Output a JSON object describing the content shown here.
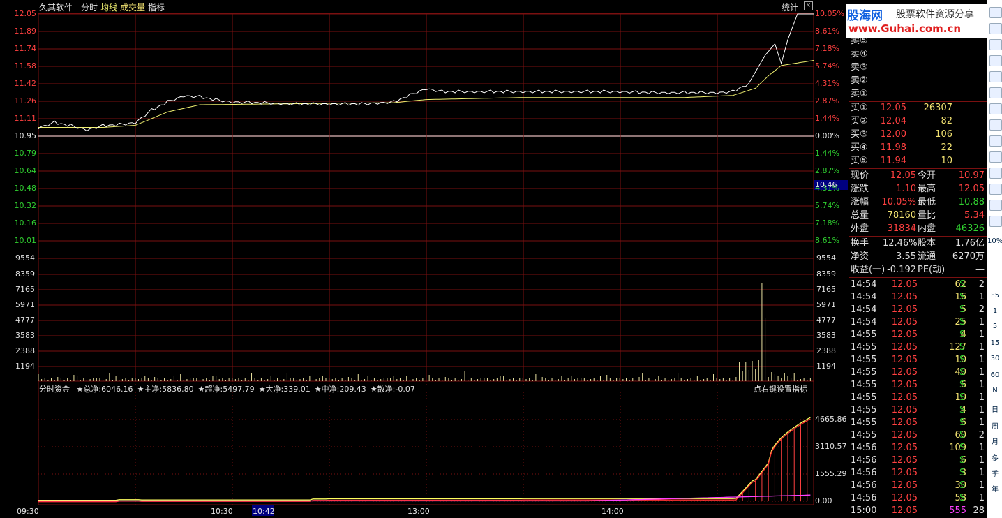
{
  "topbar": {
    "app": "久其软件",
    "tabs": [
      "分时",
      "均线",
      "成交量",
      "指标"
    ],
    "stat": "统计"
  },
  "colors": {
    "price_line": "#ffffff",
    "avg_line": "#f0f070",
    "up": "#ff4040",
    "down": "#30d030",
    "grid": "#7a1010",
    "capital_main": "#ff3030",
    "capital_total": "#ffff60",
    "capital_small": "#ff40ff"
  },
  "price_axis": {
    "left": [
      "12.05",
      "11.89",
      "11.74",
      "11.58",
      "11.42",
      "11.26",
      "11.11",
      "10.95",
      "10.79",
      "10.64",
      "10.48",
      "10.32",
      "10.16",
      "10.01"
    ],
    "right": [
      "10.05%",
      "8.61%",
      "7.18%",
      "5.74%",
      "4.31%",
      "2.87%",
      "1.44%",
      "0.00%",
      "1.44%",
      "2.87%",
      "4.31%",
      "5.74%",
      "7.18%",
      "8.61%"
    ],
    "prev_close": 10.95,
    "max": 12.05,
    "min": 9.85,
    "cursor_label": "10.46"
  },
  "volume_axis": [
    "9554",
    "8359",
    "7165",
    "5971",
    "4777",
    "3583",
    "2388",
    "1194"
  ],
  "capital_header": {
    "title": "分时资金",
    "items": [
      "★总净:6046.16",
      "★主净:5836.80",
      "★超净:5497.79",
      "★大净:339.01",
      "★中净:209.43",
      "★散净:-0.07"
    ],
    "hint": "点右键设置指标"
  },
  "capital_axis": [
    "4665.86",
    "3110.57",
    "1555.29",
    "0.00"
  ],
  "time_axis": {
    "labels": [
      "09:30",
      "10:30",
      "13:00",
      "14:00"
    ],
    "cursor": "10:42"
  },
  "chart_data": {
    "type": "line",
    "price_series_samples": [
      [
        0,
        10.95
      ],
      [
        5,
        11.0
      ],
      [
        10,
        10.97
      ],
      [
        15,
        10.93
      ],
      [
        20,
        10.97
      ],
      [
        25,
        10.98
      ],
      [
        30,
        11.0
      ],
      [
        35,
        11.12
      ],
      [
        40,
        11.2
      ],
      [
        45,
        11.26
      ],
      [
        50,
        11.25
      ],
      [
        55,
        11.22
      ],
      [
        60,
        11.2
      ],
      [
        70,
        11.19
      ],
      [
        80,
        11.18
      ],
      [
        90,
        11.18
      ],
      [
        100,
        11.18
      ],
      [
        110,
        11.2
      ],
      [
        120,
        11.33
      ],
      [
        125,
        11.3
      ],
      [
        130,
        11.3
      ],
      [
        140,
        11.3
      ],
      [
        150,
        11.3
      ],
      [
        160,
        11.3
      ],
      [
        170,
        11.3
      ],
      [
        180,
        11.3
      ],
      [
        190,
        11.29
      ],
      [
        200,
        11.29
      ],
      [
        210,
        11.29
      ],
      [
        215,
        11.3
      ],
      [
        220,
        11.38
      ],
      [
        225,
        11.65
      ],
      [
        228,
        11.76
      ],
      [
        230,
        11.57
      ],
      [
        232,
        11.8
      ],
      [
        235,
        12.05
      ],
      [
        240,
        12.05
      ]
    ],
    "avg_series_samples": [
      [
        0,
        10.95
      ],
      [
        20,
        10.95
      ],
      [
        30,
        10.97
      ],
      [
        40,
        11.1
      ],
      [
        50,
        11.17
      ],
      [
        80,
        11.18
      ],
      [
        110,
        11.19
      ],
      [
        120,
        11.22
      ],
      [
        150,
        11.24
      ],
      [
        200,
        11.24
      ],
      [
        215,
        11.26
      ],
      [
        222,
        11.33
      ],
      [
        226,
        11.45
      ],
      [
        230,
        11.55
      ],
      [
        240,
        11.6
      ],
      [
        260,
        11.62
      ],
      [
        280,
        11.62
      ]
    ],
    "xlabel": "",
    "ylabel": ""
  },
  "order_book": {
    "sell": [
      {
        "label": "卖⑤"
      },
      {
        "label": "卖④"
      },
      {
        "label": "卖③"
      },
      {
        "label": "卖②"
      },
      {
        "label": "卖①"
      }
    ],
    "buy": [
      {
        "label": "买①",
        "price": "12.05",
        "vol": "26307"
      },
      {
        "label": "买②",
        "price": "12.04",
        "vol": "82"
      },
      {
        "label": "买③",
        "price": "12.00",
        "vol": "106"
      },
      {
        "label": "买④",
        "price": "11.98",
        "vol": "22"
      },
      {
        "label": "买⑤",
        "price": "11.94",
        "vol": "10"
      }
    ]
  },
  "quote": [
    {
      "k1": "现价",
      "v1": "12.05",
      "k2": "今开",
      "v2": "10.97"
    },
    {
      "k1": "涨跌",
      "v1": "1.10",
      "k2": "最高",
      "v2": "12.05"
    },
    {
      "k1": "涨幅",
      "v1": "10.05%",
      "k2": "最低",
      "v2": "10.88"
    },
    {
      "k1": "总量",
      "v1": "78160",
      "k2": "量比",
      "v2": "5.34"
    },
    {
      "k1": "外盘",
      "v1": "31834",
      "k2": "内盘",
      "v2": "46326"
    }
  ],
  "fundamentals": [
    {
      "k1": "换手",
      "v1": "12.46%",
      "k2": "股本",
      "v2": "1.76亿"
    },
    {
      "k1": "净资",
      "v1": "3.55",
      "k2": "流通",
      "v2": "6270万"
    },
    {
      "k1": "收益(一)",
      "v1": "-0.192",
      "k2": "PE(动)",
      "v2": "—"
    }
  ],
  "ticks": [
    {
      "t": "14:54",
      "p": "12.05",
      "v": "62",
      "s": "S",
      "n": "2"
    },
    {
      "t": "14:54",
      "p": "12.05",
      "v": "16",
      "s": "S",
      "n": "1"
    },
    {
      "t": "14:54",
      "p": "12.05",
      "v": "5",
      "s": "S",
      "n": "2"
    },
    {
      "t": "14:54",
      "p": "12.05",
      "v": "25",
      "s": "S",
      "n": "1"
    },
    {
      "t": "14:55",
      "p": "12.05",
      "v": "4",
      "s": "S",
      "n": "1"
    },
    {
      "t": "14:55",
      "p": "12.05",
      "v": "127",
      "s": "S",
      "n": "1"
    },
    {
      "t": "14:55",
      "p": "12.05",
      "v": "10",
      "s": "S",
      "n": "1"
    },
    {
      "t": "14:55",
      "p": "12.05",
      "v": "40",
      "s": "S",
      "n": "1"
    },
    {
      "t": "14:55",
      "p": "12.05",
      "v": "6",
      "s": "S",
      "n": "1"
    },
    {
      "t": "14:55",
      "p": "12.05",
      "v": "10",
      "s": "S",
      "n": "1"
    },
    {
      "t": "14:55",
      "p": "12.05",
      "v": "4",
      "s": "S",
      "n": "1"
    },
    {
      "t": "14:55",
      "p": "12.05",
      "v": "6",
      "s": "S",
      "n": "1"
    },
    {
      "t": "14:55",
      "p": "12.05",
      "v": "60",
      "s": "S",
      "n": "2"
    },
    {
      "t": "14:56",
      "p": "12.05",
      "v": "109",
      "s": "S",
      "n": "1"
    },
    {
      "t": "14:56",
      "p": "12.05",
      "v": "6",
      "s": "S",
      "n": "1"
    },
    {
      "t": "14:56",
      "p": "12.05",
      "v": "3",
      "s": "S",
      "n": "1"
    },
    {
      "t": "14:56",
      "p": "12.05",
      "v": "30",
      "s": "S",
      "n": "1"
    },
    {
      "t": "14:56",
      "p": "12.05",
      "v": "58",
      "s": "S",
      "n": "1"
    },
    {
      "t": "15:00",
      "p": "12.05",
      "v": "555",
      "s": "",
      "n": "28"
    }
  ],
  "logo": {
    "name": "股海网",
    "slogan": "股票软件资源分享",
    "url": "www.Guhai.com.cn"
  },
  "toolbar": {
    "labels": [
      "10%",
      "F5",
      "1",
      "5",
      "15",
      "30",
      "60",
      "N",
      "日",
      "周",
      "月",
      "多",
      "季",
      "年"
    ]
  }
}
